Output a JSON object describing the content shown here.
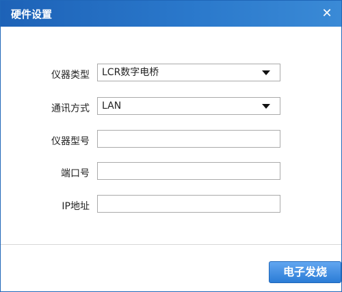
{
  "window": {
    "title": "硬件设置"
  },
  "icons": {
    "close": "close-icon",
    "dropdown": "chevron-down-icon"
  },
  "form": {
    "instrument_type": {
      "label": "仪器类型",
      "value": "LCR数字电桥"
    },
    "comm_mode": {
      "label": "通讯方式",
      "value": "LAN"
    },
    "instrument_model": {
      "label": "仪器型号",
      "value": ""
    },
    "port": {
      "label": "端口号",
      "value": ""
    },
    "ip_address": {
      "label": "IP地址",
      "value": ""
    }
  },
  "footer": {
    "button_text": "电子发烧"
  },
  "colors": {
    "accent": "#2a78cb",
    "border": "#a9a9a9"
  }
}
